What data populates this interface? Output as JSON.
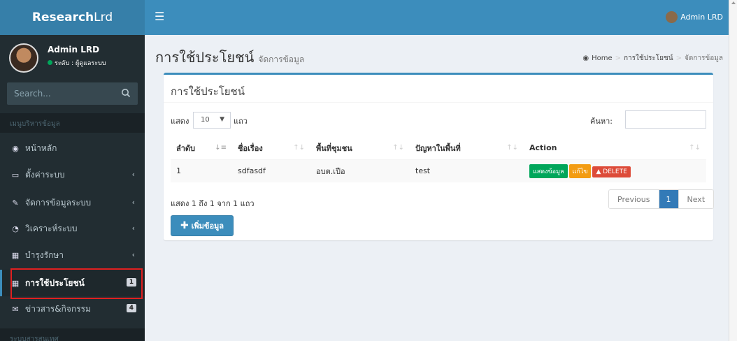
{
  "app": {
    "logo_bold": "Research",
    "logo_light": "Lrd"
  },
  "topbar": {
    "toggle_icon": "hamburger-icon",
    "user_name": "Admin LRD"
  },
  "sidebar": {
    "user_name": "Admin LRD",
    "user_status": "ระดับ : ผู้ดูแลระบบ",
    "search_placeholder": "Search...",
    "section_main": "เมนูบริหารข้อมูล",
    "items": [
      {
        "label": "หน้าหลัก",
        "icon": "dashboard-icon"
      },
      {
        "label": "ตั้งค่าระบบ",
        "icon": "laptop-icon"
      },
      {
        "label": "จัดการข้อมูลระบบ",
        "icon": "edit-icon"
      },
      {
        "label": "วิเคราะห์ระบบ",
        "icon": "pie-chart-icon"
      },
      {
        "label": "บำรุงรักษา",
        "icon": "table-icon"
      },
      {
        "label": "การใช้ประโยชน์",
        "icon": "calendar-icon",
        "badge": "1"
      },
      {
        "label": "ข่าวสาร&กิจกรรม",
        "icon": "envelope-icon",
        "badge": "4"
      }
    ],
    "section_info": "ระบบสารสนเทศ"
  },
  "page": {
    "title": "การใช้ประโยชน์",
    "subtitle": "จัดการข้อมูล",
    "breadcrumb": [
      "Home",
      "การใช้ประโยชน์",
      "จัดการข้อมูล"
    ]
  },
  "box": {
    "title": "การใช้ประโยชน์",
    "length_prefix": "แสดง",
    "length_value": "10",
    "length_suffix": "แถว",
    "search_label": "ค้นหา:",
    "columns": [
      "ลำดับ",
      "ชื่อเรื่อง",
      "พื้นที่ชุมชน",
      "ปัญหาในพื้นที่",
      "Action"
    ],
    "rows": [
      {
        "no": "1",
        "subject": "sdfasdf",
        "area": "อบต.เปือ",
        "problem": "test"
      }
    ],
    "actions": {
      "view": "แสดงข้อมูล",
      "edit": "แก้ไข",
      "delete": "DELETE"
    },
    "info": "แสดง 1 ถึง 1 จาก 1 แถว",
    "pagination": {
      "previous": "Previous",
      "current": "1",
      "next": "Next"
    },
    "add_label": "เพิ่มข้อมูล"
  },
  "colors": {
    "brand": "#3c8dbc",
    "sidebar_bg": "#222d32",
    "highlight": "#e02020"
  }
}
